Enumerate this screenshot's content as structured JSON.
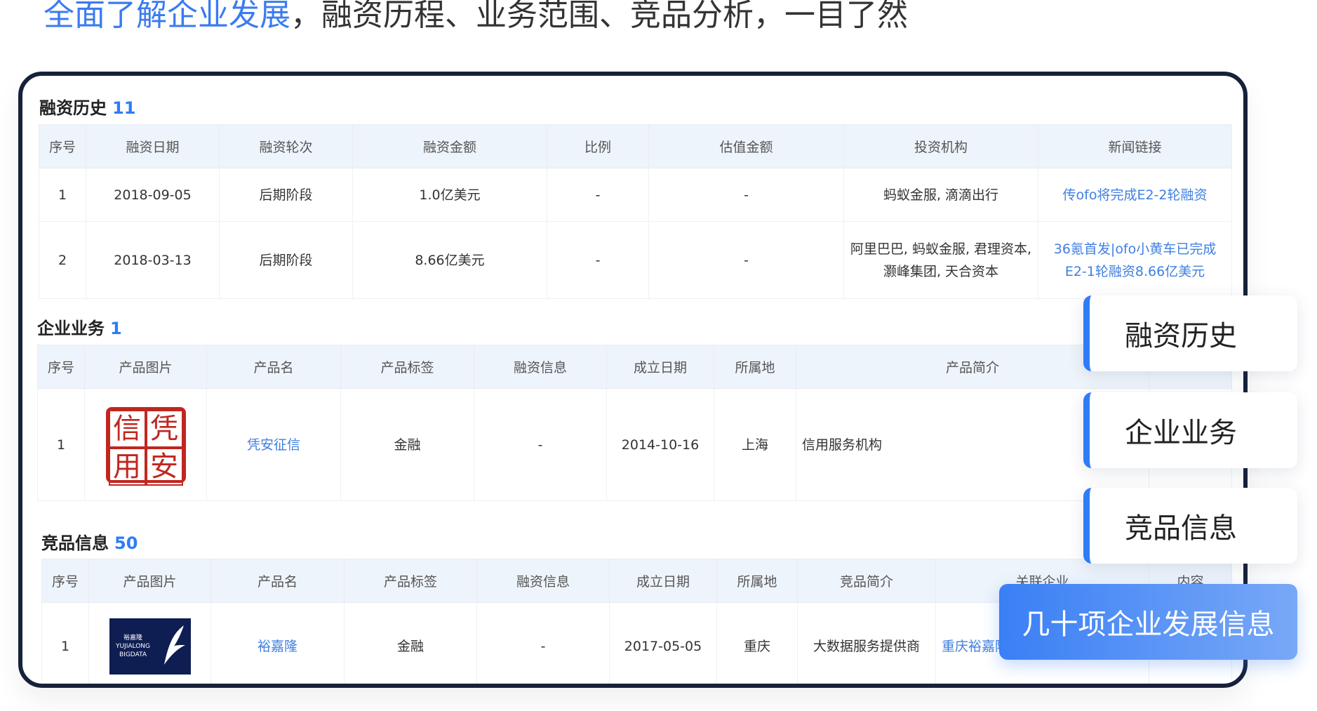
{
  "headline": {
    "highlight": "全面了解企业发展",
    "rest": "，融资历程、业务范围、竞品分析，一目了然"
  },
  "financing": {
    "title": "融资历史",
    "count": "11",
    "headers": [
      "序号",
      "融资日期",
      "融资轮次",
      "融资金额",
      "比例",
      "估值金额",
      "投资机构",
      "新闻链接"
    ],
    "rows": [
      [
        "1",
        "2018-09-05",
        "后期阶段",
        "1.0亿美元",
        "-",
        "-",
        "蚂蚁金服, 滴滴出行",
        "传ofo将完成E2-2轮融资"
      ],
      [
        "2",
        "2018-03-13",
        "后期阶段",
        "8.66亿美元",
        "-",
        "-",
        "阿里巴巴, 蚂蚁金服, 君理资本, 灏峰集团, 天合资本",
        "36氪首发|ofo小黄车已完成E2-1轮融资8.66亿美元"
      ]
    ]
  },
  "business": {
    "title": "企业业务",
    "count": "1",
    "headers": [
      "序号",
      "产品图片",
      "产品名",
      "产品标签",
      "融资信息",
      "成立日期",
      "所属地",
      "产品简介",
      ""
    ],
    "rows": [
      [
        "1",
        "凭安征信",
        "金融",
        "-",
        "2014-10-16",
        "上海",
        "信用服务机构",
        ""
      ]
    ],
    "logo_text": [
      "信",
      "凭",
      "用",
      "安"
    ]
  },
  "competitors": {
    "title": "竞品信息",
    "count": "50",
    "headers": [
      "序号",
      "产品图片",
      "产品名",
      "产品标签",
      "融资信息",
      "成立日期",
      "所属地",
      "竞品简介",
      "关联企业",
      "内容"
    ],
    "rows": [
      [
        "1",
        "裕嘉隆",
        "金融",
        "-",
        "2017-05-05",
        "重庆",
        "大数据服务提供商",
        "重庆裕嘉隆公司",
        ""
      ]
    ],
    "logo_text": "裕嘉隆 YUJIALONG BIGDATA"
  },
  "side_tabs": [
    "融资历史",
    "企业业务",
    "竞品信息"
  ],
  "cta": "几十项企业发展信息"
}
